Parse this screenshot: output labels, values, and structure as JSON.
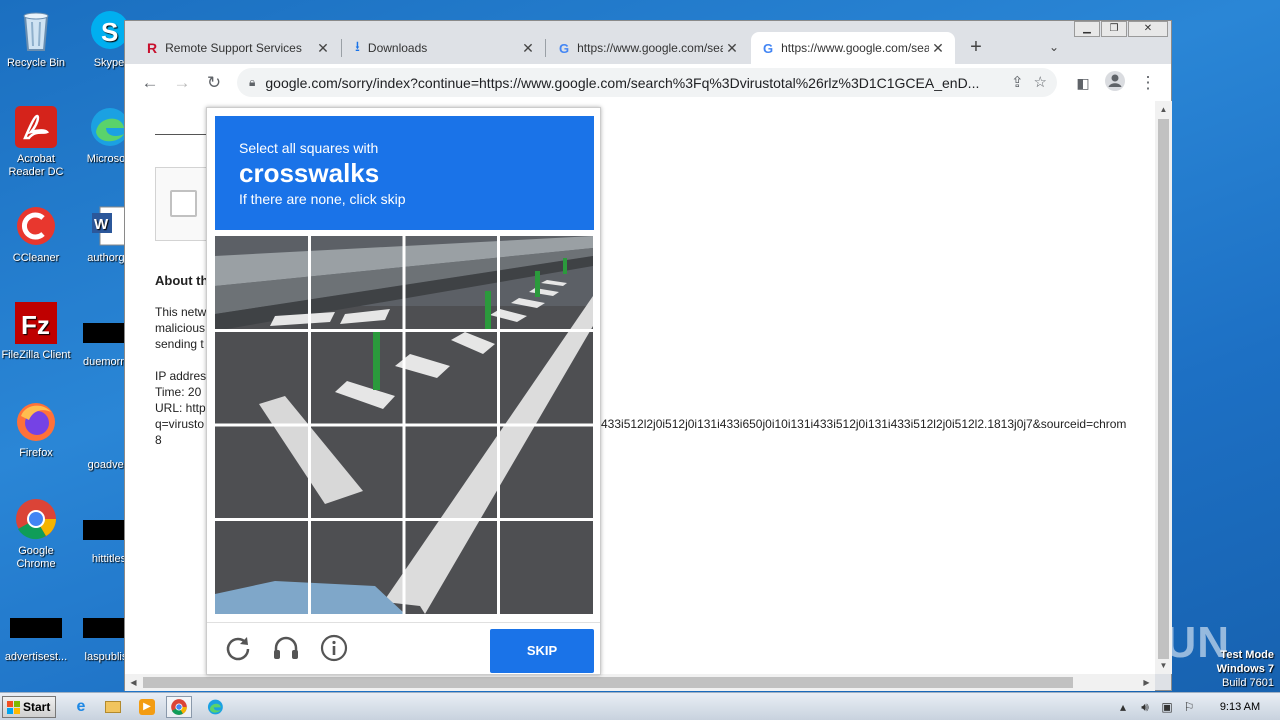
{
  "desktop": {
    "icons": [
      {
        "label": "Recycle Bin",
        "icon": "recycle-bin-icon"
      },
      {
        "label": "Skype",
        "icon": "skype-icon"
      },
      {
        "label": "Acrobat Reader DC",
        "icon": "acrobat-icon"
      },
      {
        "label": "Microsoft",
        "icon": "edge-icon"
      },
      {
        "label": "CCleaner",
        "icon": "ccleaner-icon"
      },
      {
        "label": "authorgo",
        "icon": "word-doc-icon"
      },
      {
        "label": "FileZilla Client",
        "icon": "filezilla-icon"
      },
      {
        "label": "duemornin",
        "icon": "black-file-icon"
      },
      {
        "label": "Firefox",
        "icon": "firefox-icon"
      },
      {
        "label": "goadvert",
        "icon": "blank-file-icon"
      },
      {
        "label": "Google Chrome",
        "icon": "chrome-icon"
      },
      {
        "label": "hittitles",
        "icon": "black-file-icon"
      },
      {
        "label": "advertisest...",
        "icon": "black-file-icon"
      },
      {
        "label": "laspublish",
        "icon": "black-file-icon"
      }
    ],
    "watermark": "ANY RUN",
    "test_mode": {
      "line1": "Test Mode",
      "line2": "Windows 7",
      "line3": "Build 7601"
    }
  },
  "browser": {
    "tabs": [
      {
        "title": "Remote Support Services",
        "icon": "remote-support-icon",
        "active": false
      },
      {
        "title": "Downloads",
        "icon": "download-icon",
        "active": false
      },
      {
        "title": "https://www.google.com/sea",
        "icon": "google-icon",
        "active": false
      },
      {
        "title": "https://www.google.com/sea",
        "icon": "google-icon",
        "active": true
      }
    ],
    "new_tab": "+",
    "tab_close": "✕",
    "url": "google.com/sorry/index?continue=https://www.google.com/search%3Fq%3Dvirustotal%26rlz%3D1C1GCEA_enD..."
  },
  "page": {
    "about_label": "About th",
    "para_lines": [
      "This netw",
      "malicious",
      "sending t"
    ],
    "info_lines": [
      "IP addres",
      "Time: 20",
      "URL: http"
    ],
    "url_cont": "q=virusto",
    "url_tail": "433i512l2j0i512j0i131i433i650j0i10i131i433i512j0i131i433i512l2j0i512l2.1813j0j7&sourceid=chrom",
    "last_line": "8"
  },
  "captcha": {
    "line1": "Select all squares with",
    "line2": "crosswalks",
    "line3": "If there are none, click skip",
    "skip_label": "SKIP",
    "grid_rows": 4,
    "grid_cols": 4
  },
  "taskbar": {
    "start_label": "Start",
    "apps": [
      "ie-icon",
      "explorer-icon",
      "media-player-icon",
      "chrome-icon",
      "edge-icon"
    ],
    "clock": "9:13 AM"
  }
}
